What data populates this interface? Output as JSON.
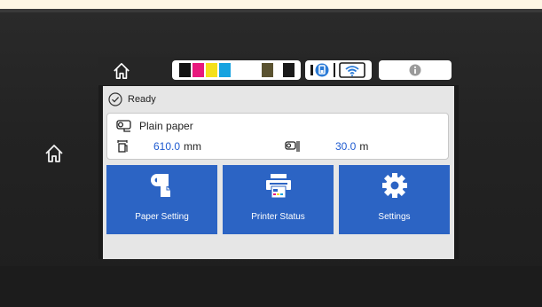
{
  "status": {
    "text": "Ready"
  },
  "paper": {
    "type": "Plain paper",
    "width_value": "610.0",
    "width_unit": "mm",
    "length_value": "30.0",
    "length_unit": "m"
  },
  "tiles": [
    {
      "label": "Paper Setting",
      "icon": "paper-roll-icon"
    },
    {
      "label": "Printer Status",
      "icon": "printer-icon"
    },
    {
      "label": "Settings",
      "icon": "gear-icon"
    }
  ],
  "ink_colors": [
    "#111111",
    "#e8197d",
    "#f4e01b",
    "#17a3e0",
    "#5a5230",
    "#1a1a1a"
  ],
  "colors": {
    "tile_blue": "#2c64c4",
    "value_blue": "#1f5bd0",
    "status_blue": "#2a7ad6"
  }
}
